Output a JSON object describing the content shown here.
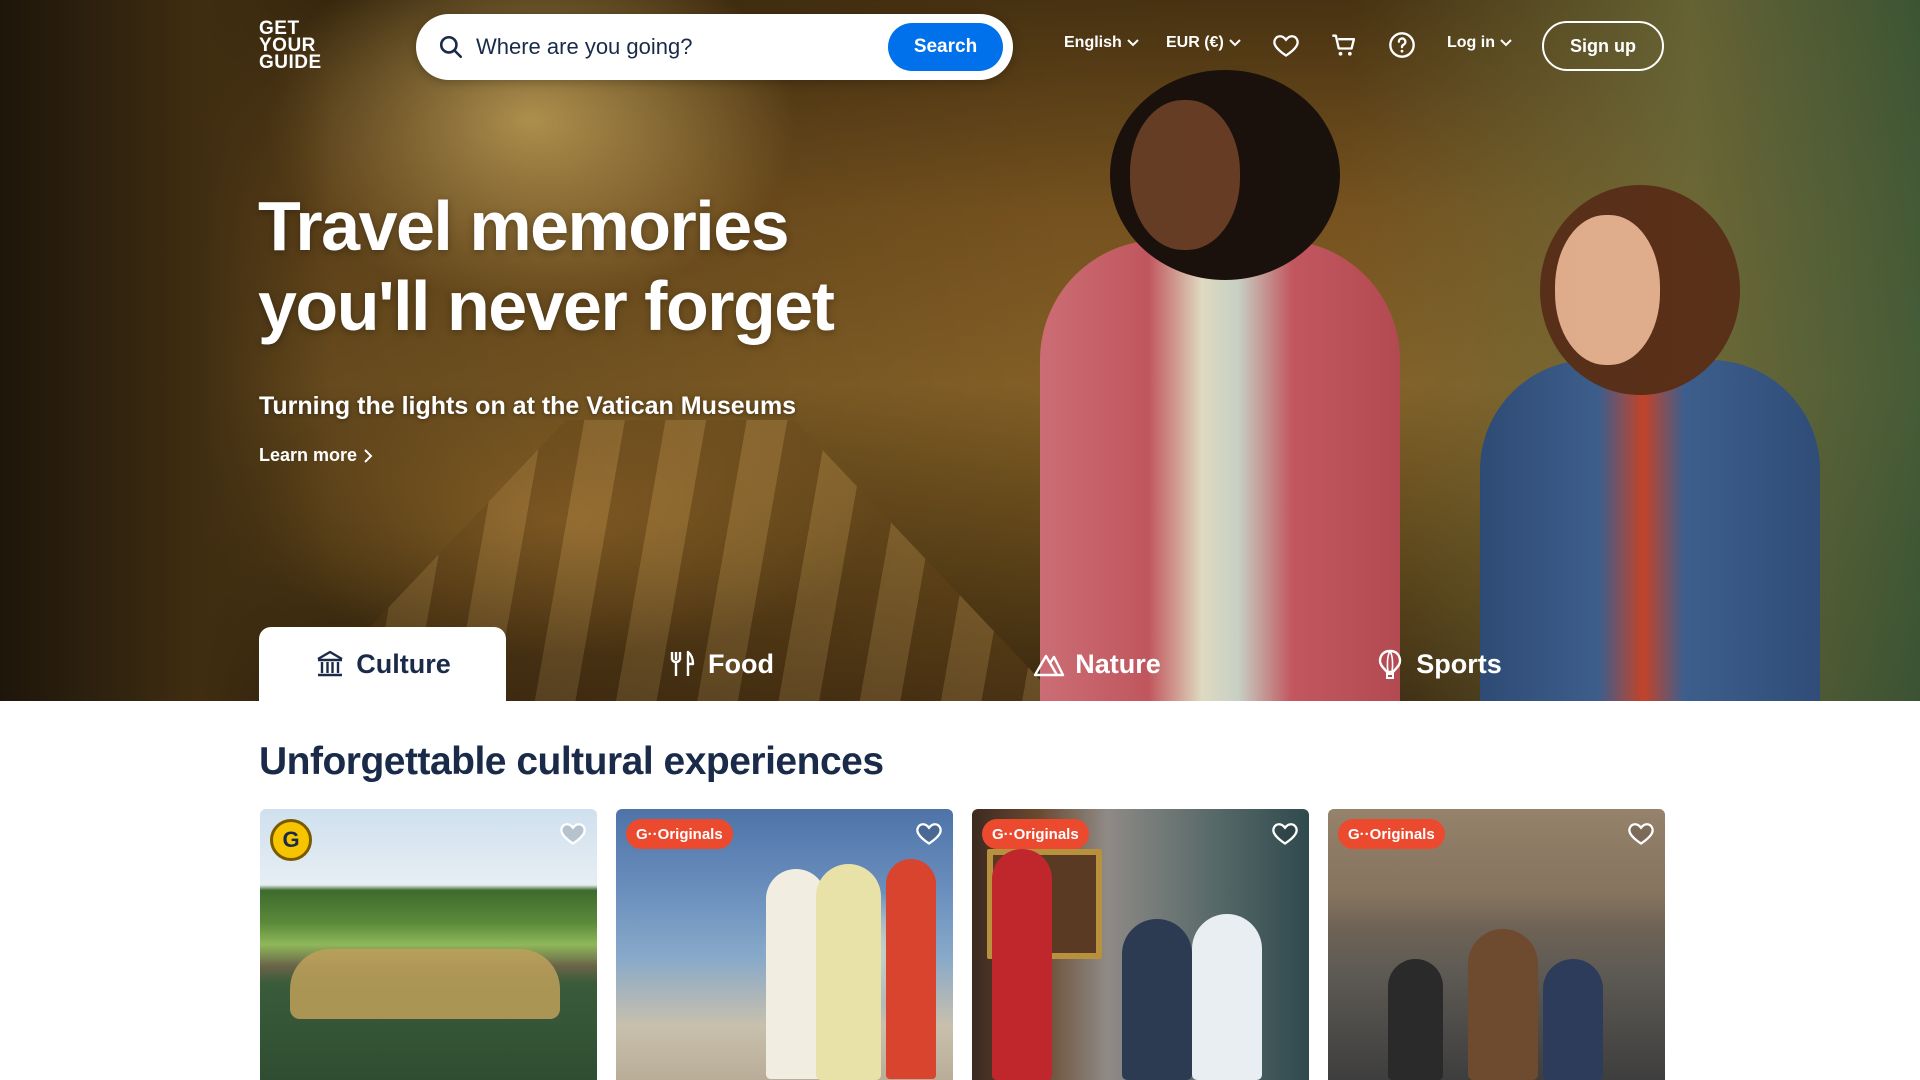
{
  "header": {
    "logo_lines": [
      "GET",
      "YOUR",
      "GUIDE"
    ],
    "search_placeholder": "Where are you going?",
    "search_button": "Search",
    "language": "English",
    "currency": "EUR (€)",
    "login": "Log in",
    "signup": "Sign up"
  },
  "hero": {
    "headline_line1": "Travel memories",
    "headline_line2": "you'll never forget",
    "subheadline": "Turning the lights on at the Vatican Museums",
    "learn_more": "Learn more"
  },
  "tabs": [
    {
      "label": "Culture",
      "icon": "museum-icon",
      "active": true
    },
    {
      "label": "Food",
      "icon": "cutlery-icon",
      "active": false
    },
    {
      "label": "Nature",
      "icon": "mountain-icon",
      "active": false
    },
    {
      "label": "Sports",
      "icon": "hot-air-balloon-icon",
      "active": false
    }
  ],
  "section": {
    "title": "Unforgettable cultural experiences"
  },
  "cards": [
    {
      "badge": "G",
      "badge_type": "certified"
    },
    {
      "badge": "G··Originals",
      "badge_type": "originals"
    },
    {
      "badge": "G··Originals",
      "badge_type": "originals"
    },
    {
      "badge": "G··Originals",
      "badge_type": "originals"
    }
  ],
  "colors": {
    "brand_blue": "#0071eb",
    "navy_text": "#1a2b49",
    "originals_red": "#eb4a2e",
    "badge_yellow": "#f6c400"
  }
}
